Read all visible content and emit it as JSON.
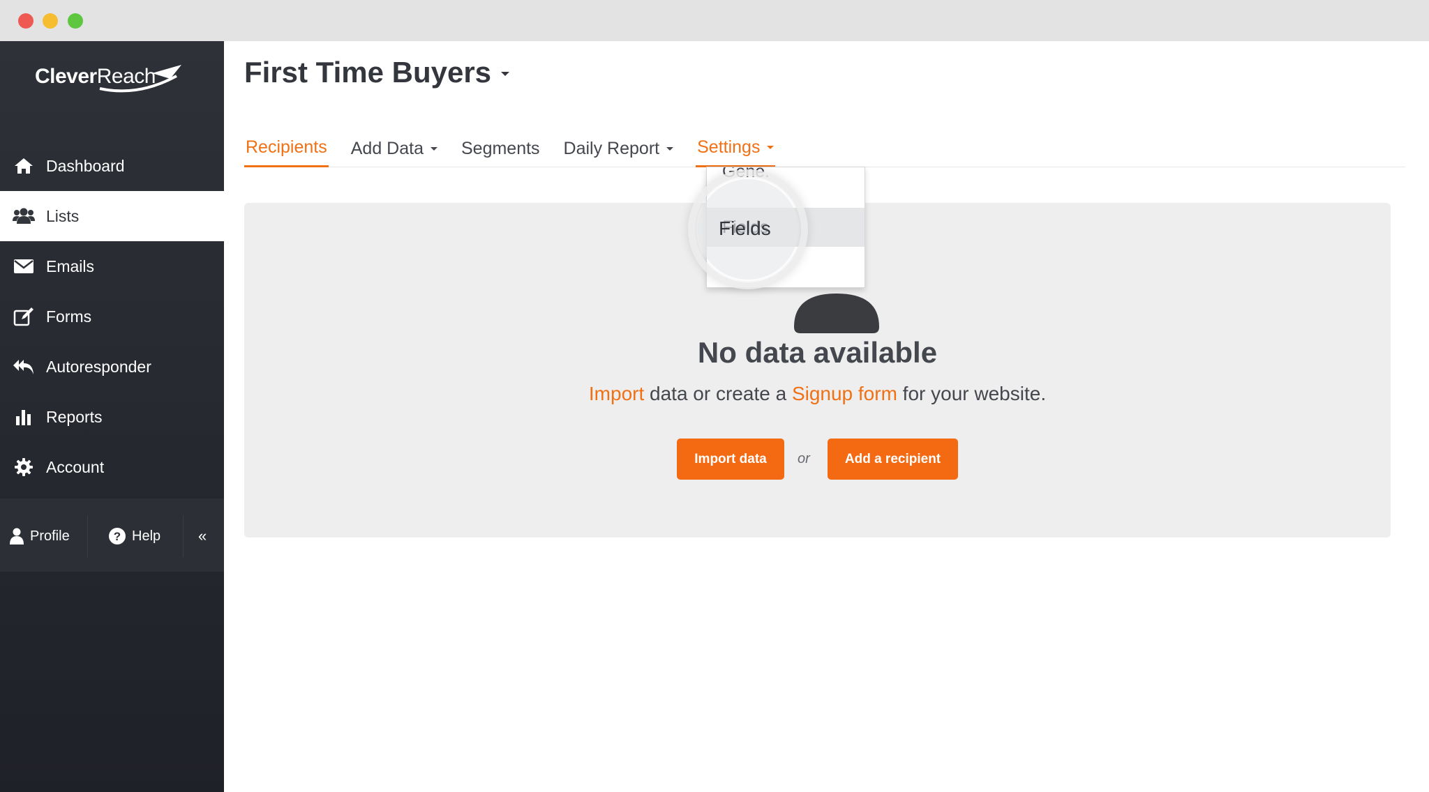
{
  "app": {
    "logo_text_bold": "Clever",
    "logo_text_light": "Reach"
  },
  "sidebar": {
    "items": [
      {
        "label": "Dashboard",
        "icon": "home-icon"
      },
      {
        "label": "Lists",
        "icon": "users-icon",
        "active": true
      },
      {
        "label": "Emails",
        "icon": "envelope-icon"
      },
      {
        "label": "Forms",
        "icon": "edit-icon"
      },
      {
        "label": "Autoresponder",
        "icon": "reply-all-icon"
      },
      {
        "label": "Reports",
        "icon": "bar-chart-icon"
      },
      {
        "label": "Account",
        "icon": "gear-icon"
      }
    ],
    "footer": {
      "profile": "Profile",
      "help": "Help",
      "collapse": "«"
    }
  },
  "header": {
    "title": "First Time Buyers"
  },
  "tabs": {
    "recipients": "Recipients",
    "add_data": "Add Data",
    "segments": "Segments",
    "daily_report": "Daily Report",
    "settings": "Settings"
  },
  "settings_menu": {
    "cut_top": "Gene.",
    "fields": "Fields",
    "cut_bottom": "...."
  },
  "empty_state": {
    "title": "No data available",
    "import_link": "Import",
    "text_mid": " data or create a ",
    "signup_link": "Signup form",
    "text_end": " for your website.",
    "import_button": "Import data",
    "or": "or",
    "add_button": "Add a recipient"
  },
  "colors": {
    "accent": "#f07115",
    "sidebar": "#2e3138",
    "panel": "#eeeeee"
  }
}
